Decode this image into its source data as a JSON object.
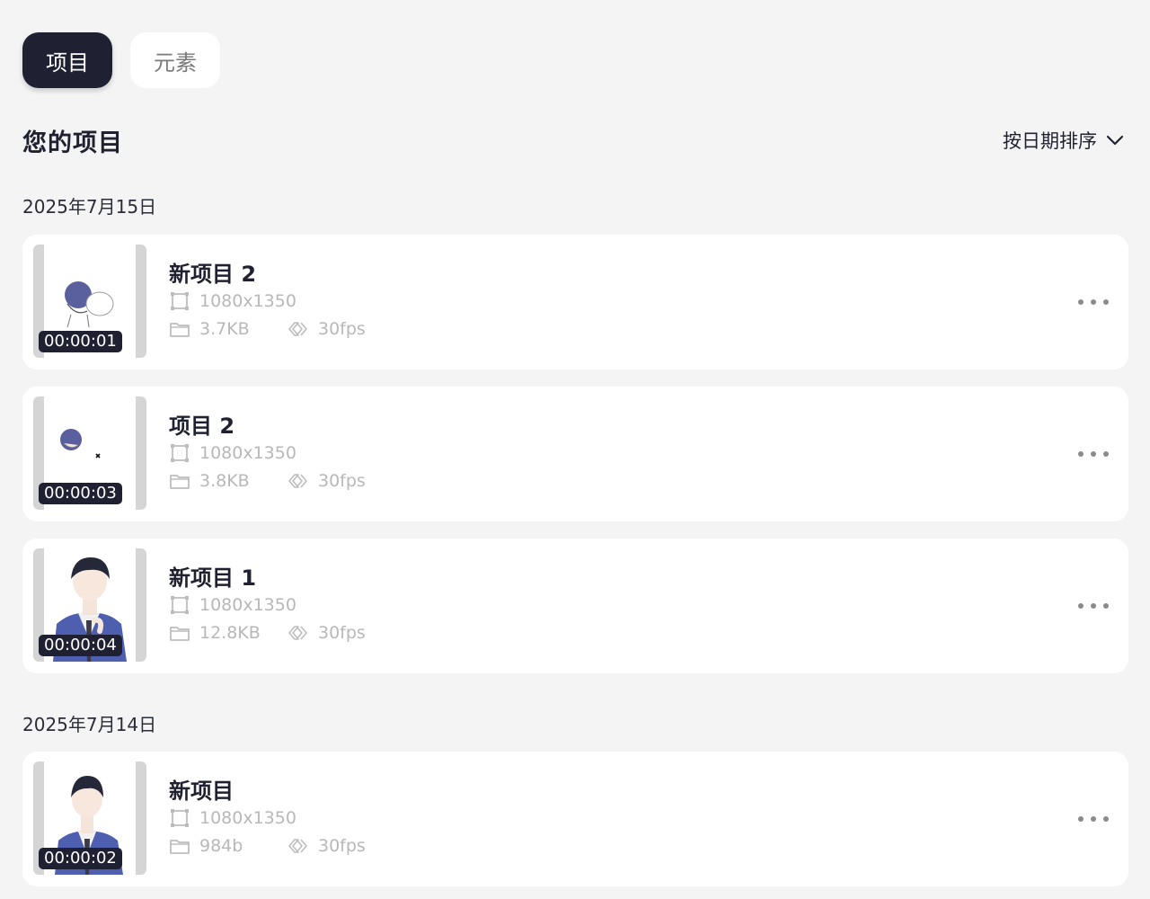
{
  "tabs": [
    {
      "label": "项目",
      "active": true
    },
    {
      "label": "元素",
      "active": false
    }
  ],
  "header": {
    "title": "您的项目",
    "sort_label": "按日期排序"
  },
  "groups": [
    {
      "date": "2025年7月15日",
      "projects": [
        {
          "title": "新项目 2",
          "duration": "00:00:01",
          "resolution": "1080x1350",
          "size": "3.7KB",
          "fps": "30fps"
        },
        {
          "title": "项目 2",
          "duration": "00:00:03",
          "resolution": "1080x1350",
          "size": "3.8KB",
          "fps": "30fps"
        },
        {
          "title": "新项目 1",
          "duration": "00:00:04",
          "resolution": "1080x1350",
          "size": "12.8KB",
          "fps": "30fps"
        }
      ]
    },
    {
      "date": "2025年7月14日",
      "projects": [
        {
          "title": "新项目",
          "duration": "00:00:02",
          "resolution": "1080x1350",
          "size": "984b",
          "fps": "30fps"
        }
      ]
    }
  ],
  "icons": {
    "resolution": "crop-frame-icon",
    "size": "folder-icon",
    "fps": "fast-forward-icon",
    "more": "more-horizontal-icon",
    "sort": "chevron-down-icon"
  },
  "colors": {
    "accent": "#1f2133",
    "background": "#f4f4f4",
    "meta_text": "#b8b8b8"
  }
}
